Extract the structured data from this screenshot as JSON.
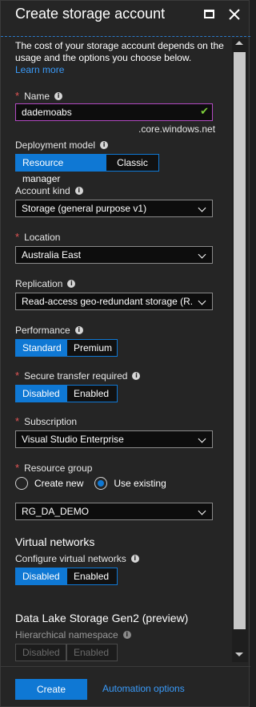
{
  "window": {
    "title": "Create storage account"
  },
  "intro": {
    "text": "The cost of your storage account depends on the usage and the options you choose below.",
    "link": "Learn more"
  },
  "name": {
    "label": "Name",
    "value": "dademoabs",
    "suffix": ".core.windows.net"
  },
  "deployment_model": {
    "label": "Deployment model",
    "options": [
      "Resource manager",
      "Classic"
    ],
    "selected": "Resource manager"
  },
  "account_kind": {
    "label": "Account kind",
    "value": "Storage (general purpose v1)"
  },
  "location": {
    "label": "Location",
    "value": "Australia East"
  },
  "replication": {
    "label": "Replication",
    "value": "Read-access geo-redundant storage (R..."
  },
  "performance": {
    "label": "Performance",
    "options": [
      "Standard",
      "Premium"
    ],
    "selected": "Standard"
  },
  "secure_transfer": {
    "label": "Secure transfer required",
    "options": [
      "Disabled",
      "Enabled"
    ],
    "selected": "Disabled"
  },
  "subscription": {
    "label": "Subscription",
    "value": "Visual Studio Enterprise"
  },
  "resource_group": {
    "label": "Resource group",
    "radio_options": [
      "Create new",
      "Use existing"
    ],
    "selected_radio": "Use existing",
    "value": "RG_DA_DEMO"
  },
  "virtual_networks": {
    "heading": "Virtual networks",
    "label": "Configure virtual networks",
    "options": [
      "Disabled",
      "Enabled"
    ],
    "selected": "Disabled"
  },
  "data_lake": {
    "heading": "Data Lake Storage Gen2 (preview)",
    "label": "Hierarchical namespace",
    "options": [
      "Disabled",
      "Enabled"
    ]
  },
  "footer": {
    "create": "Create",
    "automation": "Automation options"
  },
  "colors": {
    "accent": "#0f78d4",
    "link": "#3a9bfa",
    "required": "#e25555",
    "valid": "#7fd13b",
    "name_border": "#b24ac2"
  }
}
